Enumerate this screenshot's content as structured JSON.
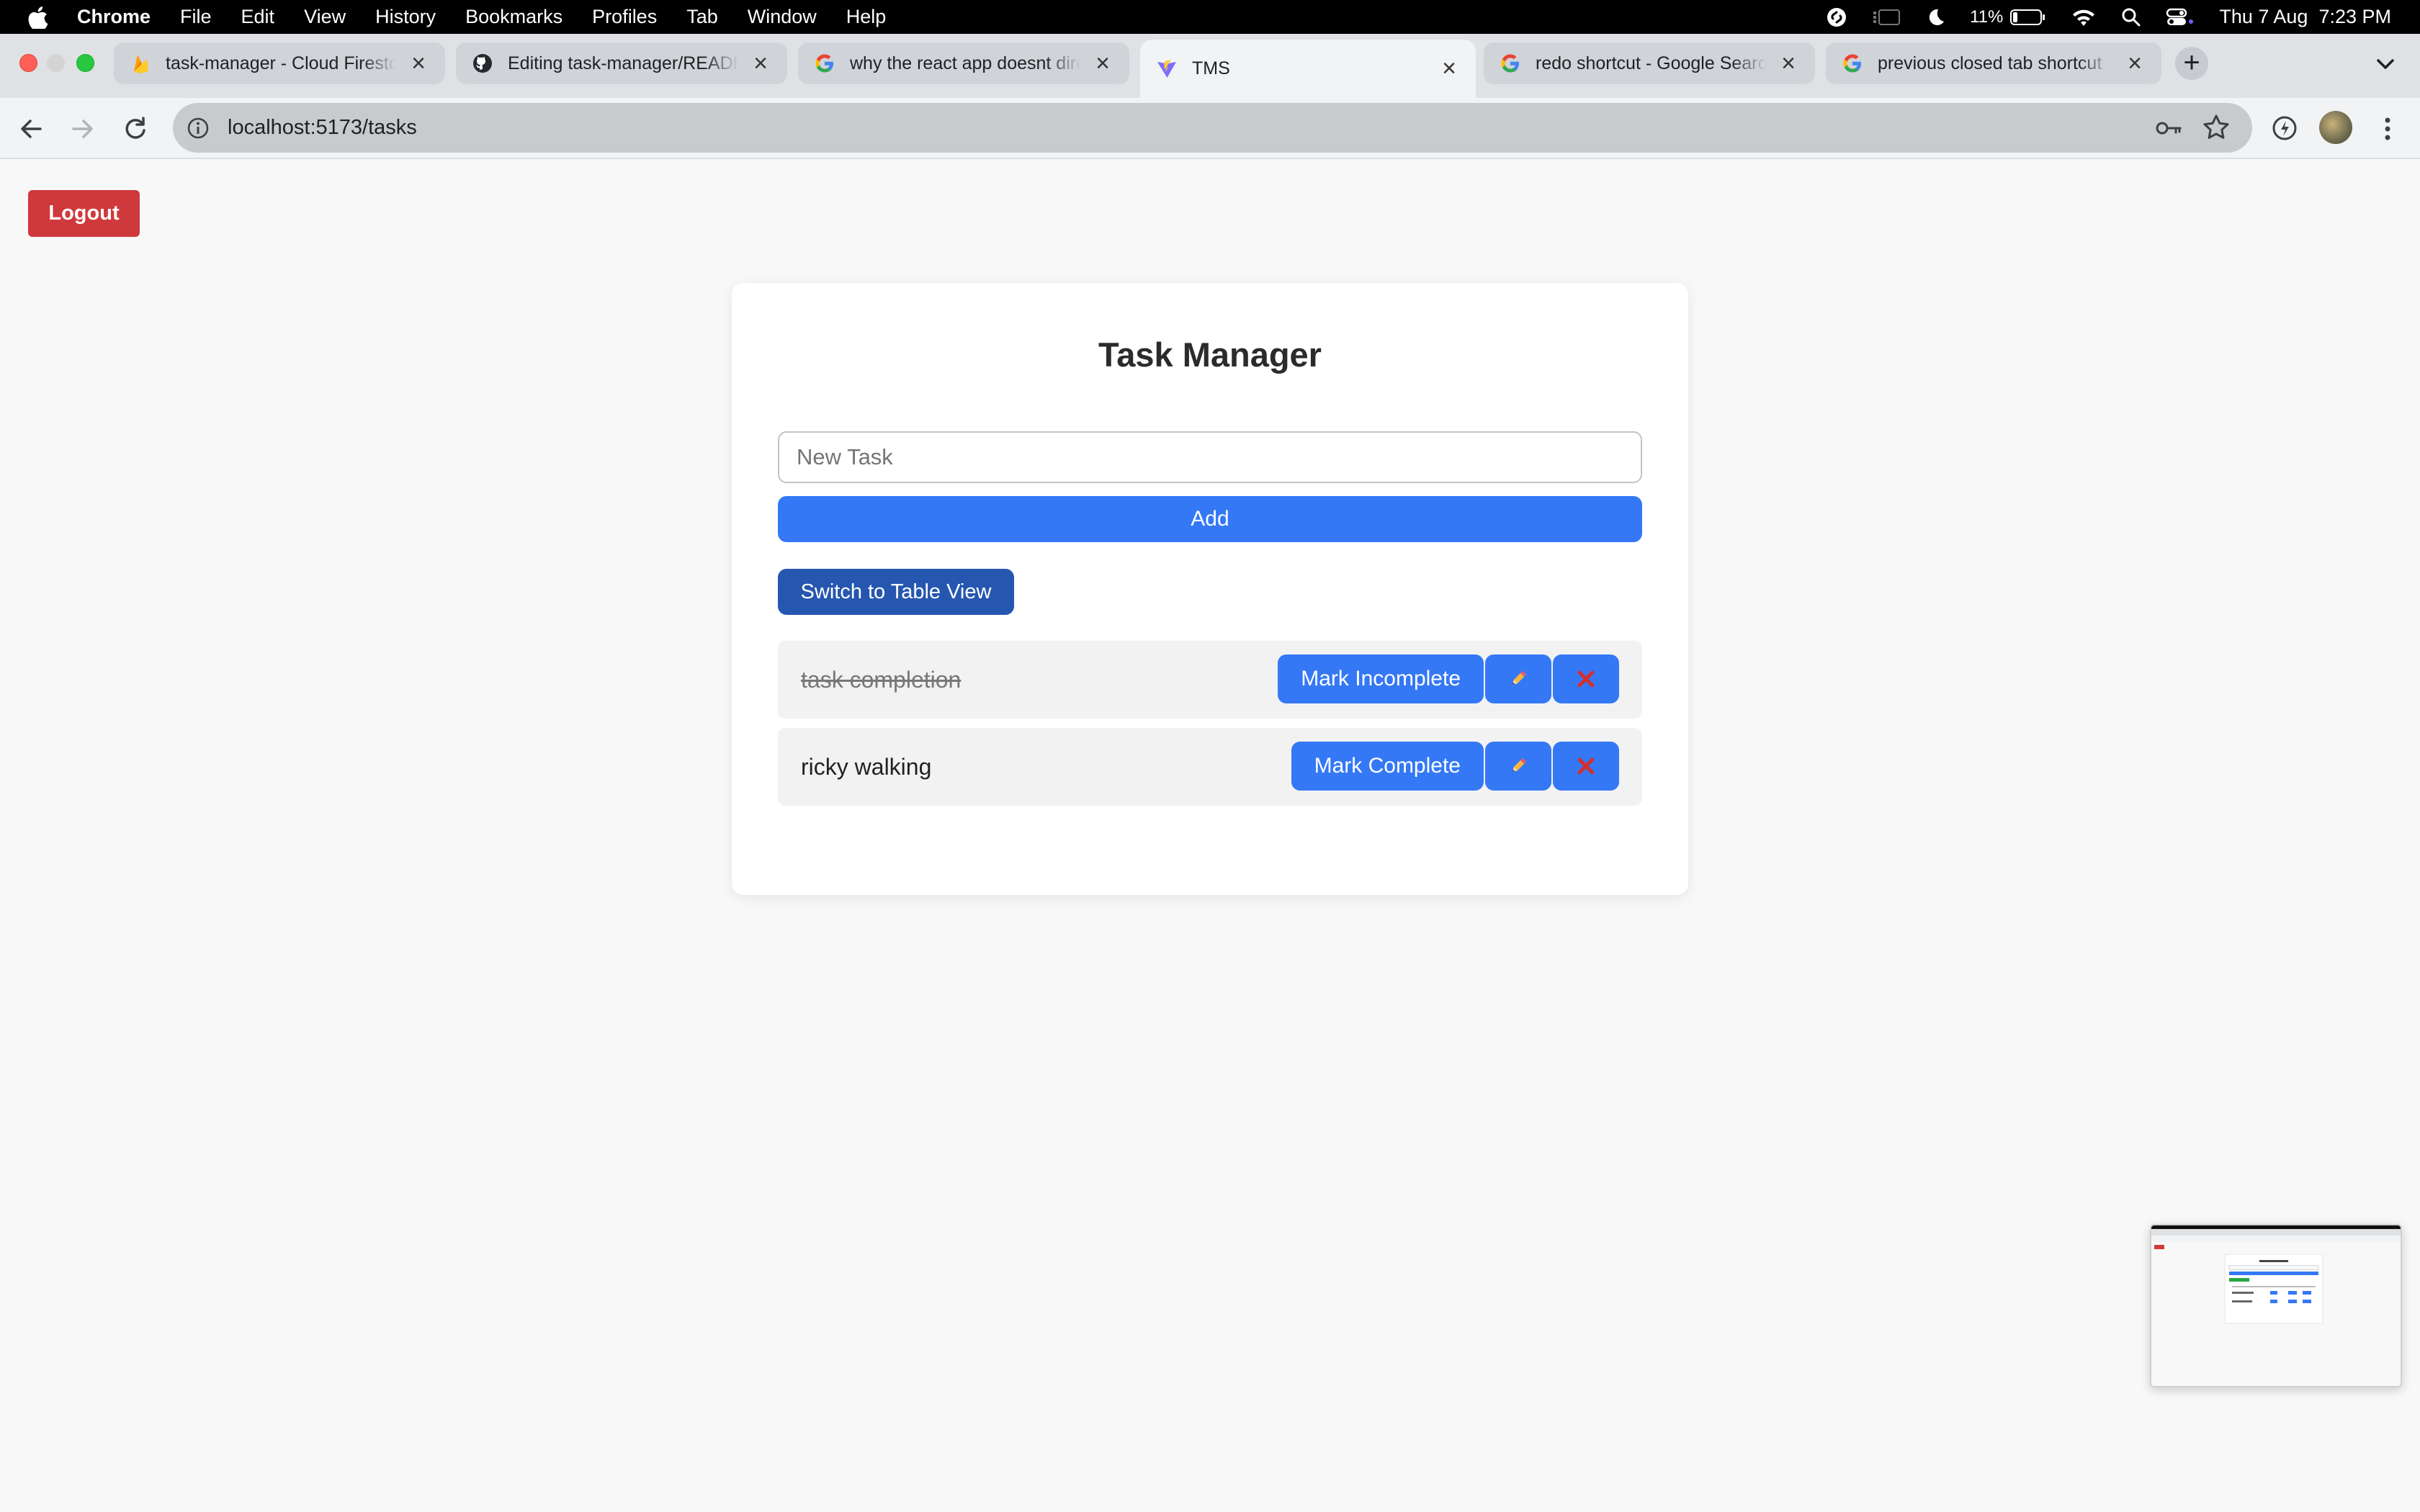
{
  "menubar": {
    "app_name": "Chrome",
    "menus": [
      "File",
      "Edit",
      "View",
      "History",
      "Bookmarks",
      "Profiles",
      "Tab",
      "Window",
      "Help"
    ],
    "battery": "11%",
    "datetime": "Thu 7 Aug  7:23 PM"
  },
  "tabs": [
    {
      "title": "task-manager - Cloud Firestore",
      "icon": "firebase-icon"
    },
    {
      "title": "Editing task-manager/README",
      "icon": "github-icon"
    },
    {
      "title": "why the react app doesnt direct",
      "icon": "google-icon"
    },
    {
      "title": "TMS",
      "icon": "vite-icon"
    },
    {
      "title": "redo shortcut - Google Search",
      "icon": "google-icon"
    },
    {
      "title": "previous closed tab shortcut",
      "icon": "google-icon"
    }
  ],
  "toolbar": {
    "url": "localhost:5173/tasks"
  },
  "page": {
    "logout_label": "Logout",
    "title": "Task Manager",
    "input_placeholder": "New Task",
    "add_label": "Add",
    "switch_label": "Switch to Table View",
    "tasks": [
      {
        "text": "task completion",
        "completed": true,
        "toggle_label": "Mark Incomplete",
        "edit_icon": "pencil-icon",
        "delete_icon": "cross-icon"
      },
      {
        "text": "ricky walking",
        "completed": false,
        "toggle_label": "Mark Complete",
        "edit_icon": "pencil-icon",
        "delete_icon": "cross-icon"
      }
    ]
  },
  "colors": {
    "logout": "#d0393c",
    "primary": "#3478f6",
    "switch": "#2657b0",
    "delete_icon": "#d32f2f"
  }
}
